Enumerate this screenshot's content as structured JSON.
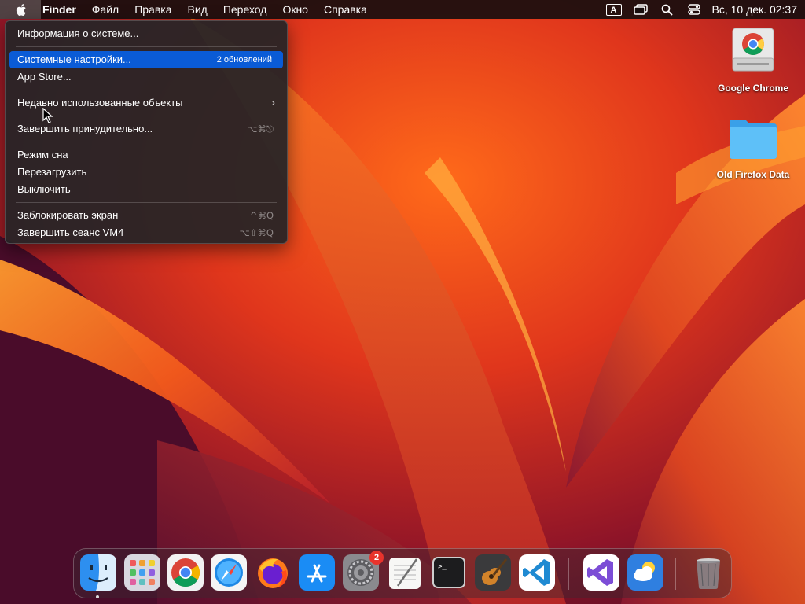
{
  "menubar": {
    "app_name": "Finder",
    "items": [
      "Файл",
      "Правка",
      "Вид",
      "Переход",
      "Окно",
      "Справка"
    ],
    "input_indicator": "A",
    "clock": "Вс, 10 дек.  02:37"
  },
  "apple_menu": {
    "about": "Информация о системе...",
    "settings": "Системные настройки...",
    "settings_badge": "2 обновлений",
    "app_store": "App Store...",
    "recent": "Недавно использованные объекты",
    "force_quit": "Завершить принудительно...",
    "force_quit_shortcut": "⌥⌘⎋",
    "sleep": "Режим сна",
    "restart": "Перезагрузить",
    "shutdown": "Выключить",
    "lock": "Заблокировать экран",
    "lock_shortcut": "^⌘Q",
    "logout": "Завершить сеанс VM4",
    "logout_shortcut": "⌥⇧⌘Q"
  },
  "desktop_icons": [
    {
      "label": "Google Chrome",
      "icon": "chrome-drive-icon"
    },
    {
      "label": "Old Firefox Data",
      "icon": "folder-icon"
    }
  ],
  "dock": {
    "apps": [
      "Finder",
      "Launchpad",
      "Google Chrome",
      "Safari",
      "Firefox",
      "App Store",
      "System Preferences",
      "TextEdit",
      "Terminal",
      "GarageBand",
      "Visual Studio Code",
      "Visual Studio",
      "Weather",
      "Trash"
    ],
    "system_preferences_badge": "2"
  },
  "colors": {
    "menu_highlight": "#0a5bd6",
    "badge_red": "#e8332c"
  }
}
